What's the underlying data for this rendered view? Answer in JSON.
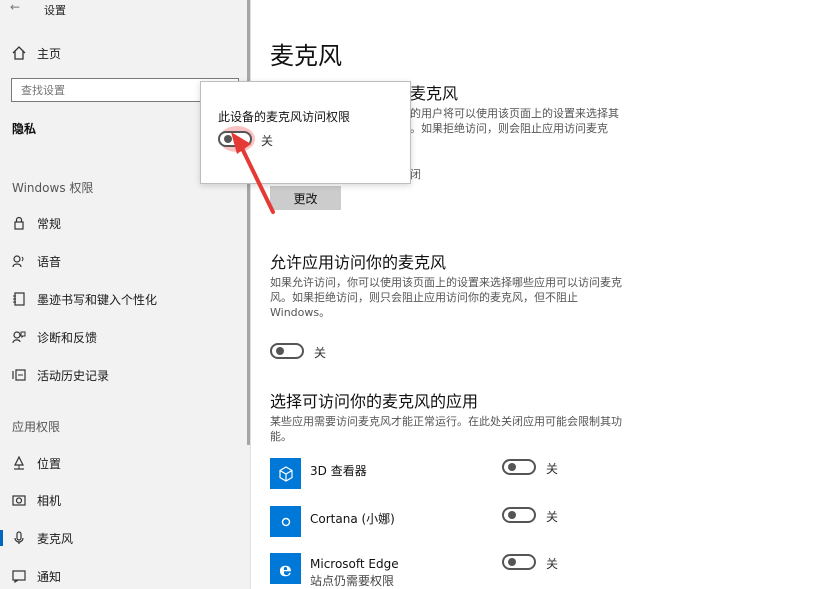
{
  "window": {
    "title": "设置",
    "back_glyph": "←"
  },
  "sidebar": {
    "home": {
      "label": "主页",
      "icon": "home-icon"
    },
    "search": {
      "placeholder": "查找设置"
    },
    "category": "隐私",
    "windows_section": "Windows 权限",
    "windows_items": [
      {
        "label": "常规",
        "icon": "lock-icon"
      },
      {
        "label": "语音",
        "icon": "speech-icon"
      },
      {
        "label": "墨迹书写和键入个性化",
        "icon": "notebook-icon"
      },
      {
        "label": "诊断和反馈",
        "icon": "feedback-icon"
      },
      {
        "label": "活动历史记录",
        "icon": "history-icon"
      }
    ],
    "app_section": "应用权限",
    "app_items": [
      {
        "label": "位置",
        "icon": "location-icon"
      },
      {
        "label": "相机",
        "icon": "camera-icon"
      },
      {
        "label": "麦克风",
        "icon": "microphone-icon",
        "active": true
      },
      {
        "label": "通知",
        "icon": "notification-icon"
      }
    ]
  },
  "main": {
    "title": "麦克风",
    "section1": {
      "heading_partial": "麦克风",
      "desc_lines": [
        "的用户将可以使用该页面上的设置来选择其",
        "。如果拒绝访问，则会阻止应用访问麦克"
      ],
      "state_partial": "闭",
      "button": "更改"
    },
    "section2": {
      "heading": "允许应用访问你的麦克风",
      "desc_lines": [
        "如果允许访问，你可以使用该页面上的设置来选择哪些应用可以访问麦克",
        "风。如果拒绝访问，则只会阻止应用访问你的麦克风，但不阻止",
        "Windows。"
      ],
      "toggle_state": "关"
    },
    "section3": {
      "heading": "选择可访问你的麦克风的应用",
      "desc_lines": [
        "某些应用需要访问麦克风才能正常运行。在此处关闭应用可能会限制其功",
        "能。"
      ],
      "apps": [
        {
          "name": "3D 查看器",
          "sub": "",
          "state": "关",
          "icon": "cube-icon"
        },
        {
          "name": "Cortana (小娜)",
          "sub": "",
          "state": "关",
          "icon": "cortana-icon"
        },
        {
          "name": "Microsoft Edge",
          "sub": "站点仍需要权限",
          "state": "关",
          "icon": "edge-icon"
        }
      ]
    }
  },
  "popup": {
    "title": "此设备的麦克风访问权限",
    "toggle_state": "关"
  },
  "colors": {
    "accent": "#0078d7",
    "highlight": "#e53935"
  }
}
